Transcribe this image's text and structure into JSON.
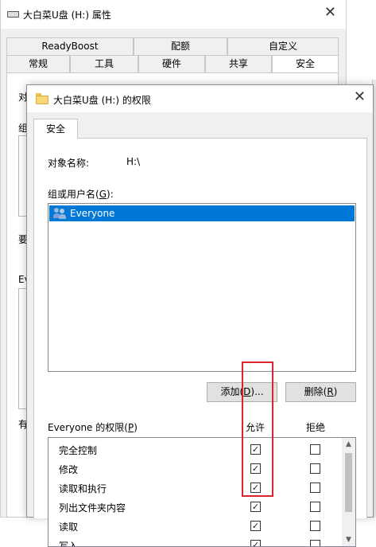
{
  "back_window": {
    "title": "大白菜U盘 (H:) 属性",
    "close_glyph": "✕",
    "tabs_row1": [
      "ReadyBoost",
      "配额",
      "自定义"
    ],
    "tabs_row2": [
      "常规",
      "工具",
      "硬件",
      "共享",
      "安全"
    ],
    "fragments": [
      "对",
      "组",
      "要",
      "Eve",
      "有"
    ]
  },
  "dialog": {
    "title": "大白菜U盘 (H:) 的权限",
    "close_glyph": "✕",
    "tab": "安全",
    "object_label": "对象名称:",
    "object_value": "H:\\",
    "group_label": "组或用户名",
    "group_label_key": "G",
    "users": [
      "Everyone"
    ],
    "add_button": "添加",
    "add_button_key": "D",
    "add_button_suffix": "...",
    "remove_button": "删除",
    "remove_button_key": "R",
    "perm_label": "Everyone 的权限",
    "perm_label_key": "P",
    "allow_header": "允许",
    "deny_header": "拒绝",
    "permissions": [
      {
        "name": "完全控制",
        "allow": true,
        "deny": false
      },
      {
        "name": "修改",
        "allow": true,
        "deny": false
      },
      {
        "name": "读取和执行",
        "allow": true,
        "deny": false
      },
      {
        "name": "列出文件夹内容",
        "allow": true,
        "deny": false
      },
      {
        "name": "读取",
        "allow": true,
        "deny": false
      },
      {
        "name": "写入",
        "allow": true,
        "deny": false
      }
    ],
    "check_glyph": "✓",
    "scroll_up": "▲",
    "scroll_down": "▼"
  },
  "colors": {
    "selection": "#0078d7",
    "highlight_box": "#d9262c",
    "dialog_bg": "#f0f0f0"
  }
}
